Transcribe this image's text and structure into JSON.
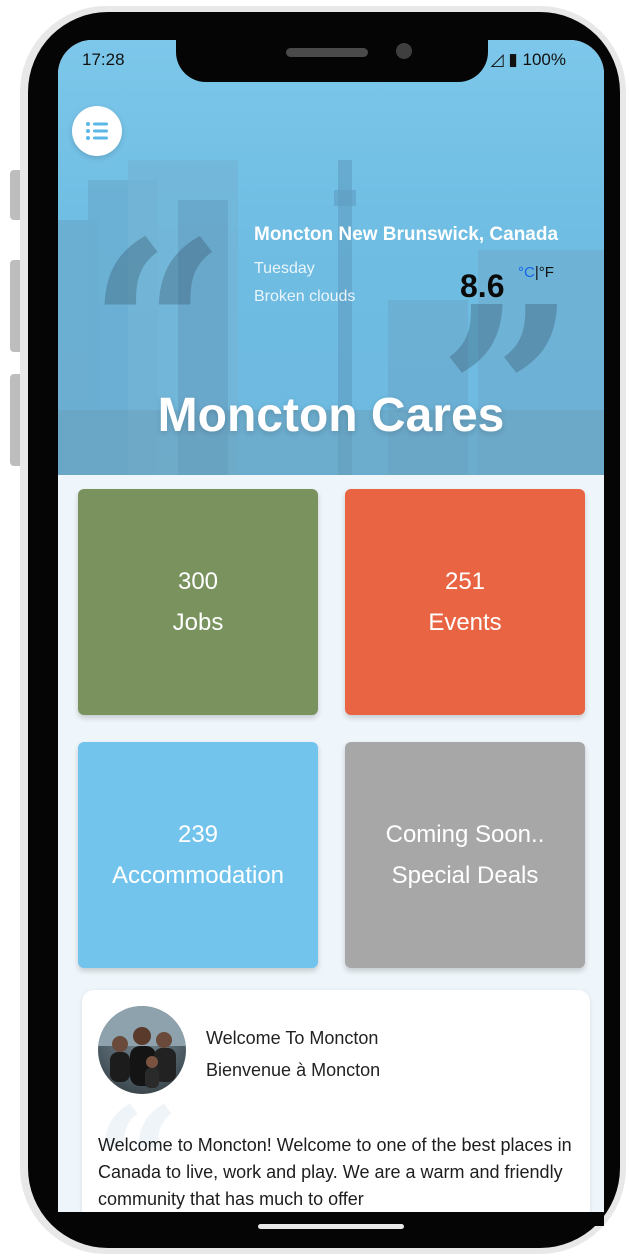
{
  "status_bar": {
    "time": "17:28",
    "battery": "100%"
  },
  "hero": {
    "location": "Moncton New Brunswick, Canada",
    "day": "Tuesday",
    "condition": "Broken clouds",
    "temperature": "8.6",
    "unit_celsius": "°C",
    "unit_separator": "|",
    "unit_fahrenheit": "°F",
    "title": "Moncton Cares"
  },
  "tiles": [
    {
      "count": "300",
      "label": "Jobs",
      "color": "#7a925e"
    },
    {
      "count": "251",
      "label": "Events",
      "color": "#e96442"
    },
    {
      "count": "239",
      "label": "Accommodation",
      "color": "#73c4ec"
    },
    {
      "count": "Coming Soon..",
      "label": "Special Deals",
      "color": "#a7a7a7"
    }
  ],
  "welcome": {
    "title": "Welcome To Moncton",
    "subtitle": "Bienvenue à Moncton",
    "body": "Welcome to Moncton! Welcome to one of the best places in Canada to live, work and play. We are a warm and friendly community that has much to offer"
  },
  "icons": {
    "menu": "menu-list-icon",
    "battery": "battery-icon",
    "signal": "signal-icon"
  }
}
